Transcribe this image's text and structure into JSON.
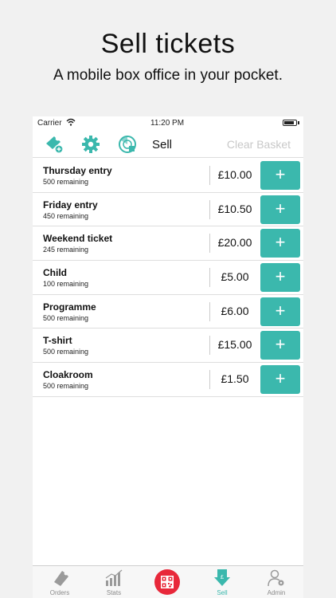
{
  "headline": "Sell tickets",
  "subline": "A mobile box office in your pocket.",
  "statusbar": {
    "carrier": "Carrier",
    "time": "11:20 PM"
  },
  "toolbar": {
    "title": "Sell",
    "clear_label": "Clear Basket"
  },
  "items": [
    {
      "name": "Thursday entry",
      "remaining": "500 remaining",
      "price": "£10.00",
      "add": "+"
    },
    {
      "name": "Friday entry",
      "remaining": "450 remaining",
      "price": "£10.50",
      "add": "+"
    },
    {
      "name": "Weekend ticket",
      "remaining": "245 remaining",
      "price": "£20.00",
      "add": "+"
    },
    {
      "name": "Child",
      "remaining": "100 remaining",
      "price": "£5.00",
      "add": "+"
    },
    {
      "name": "Programme",
      "remaining": "500 remaining",
      "price": "£6.00",
      "add": "+"
    },
    {
      "name": "T-shirt",
      "remaining": "500 remaining",
      "price": "£15.00",
      "add": "+"
    },
    {
      "name": "Cloakroom",
      "remaining": "500 remaining",
      "price": "£1.50",
      "add": "+"
    }
  ],
  "tabs": [
    {
      "label": "Orders",
      "icon": "ticket-icon"
    },
    {
      "label": "Stats",
      "icon": "chart-icon"
    },
    {
      "label": "",
      "icon": "qr-scan-icon"
    },
    {
      "label": "Sell",
      "icon": "sell-icon",
      "active": true
    },
    {
      "label": "Admin",
      "icon": "admin-icon"
    }
  ],
  "colors": {
    "accent": "#3bb8ad",
    "scan": "#e8283a",
    "muted": "#c8c8c8"
  }
}
